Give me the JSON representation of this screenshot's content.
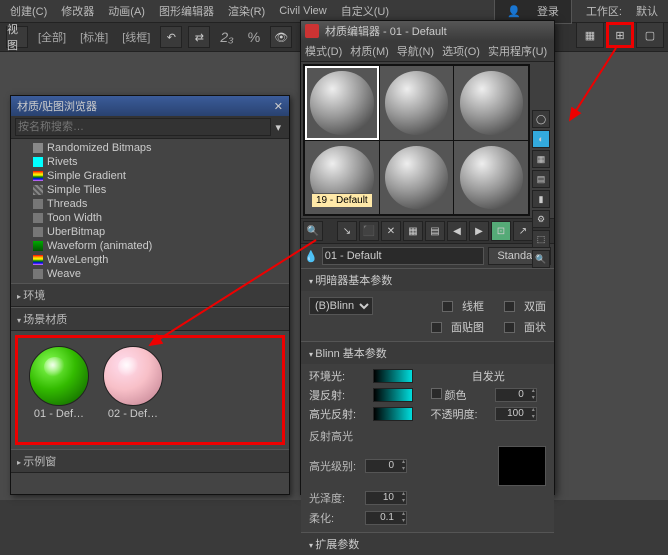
{
  "topMenu": {
    "create": "创建(C)",
    "mod": "修改器",
    "anim": "动画(A)",
    "graph": "图形编辑器",
    "render": "渲染(R)",
    "civil": "Civil View",
    "custom": "自定义(U)",
    "login": "登录",
    "workspace": "工作区:",
    "default": "默认"
  },
  "toolbar": {
    "view": "视图",
    "all": "[全部]",
    "hot": "[标准]",
    "line": "[线框]",
    "t1": "2₃",
    "tpct": "%"
  },
  "browser": {
    "title": "材质/贴图浏览器",
    "searchPh": "按名称搜索…",
    "items": [
      "Randomized Bitmaps",
      "Rivets",
      "Simple Gradient",
      "Simple Tiles",
      "Threads",
      "Toon Width",
      "UberBitmap",
      "Waveform (animated)",
      "WaveLength",
      "Weave"
    ],
    "envHdr": "环境",
    "sceneHdr": "场景材质",
    "mat1": "01 - Def…",
    "mat2": "02 - Def…",
    "sampleHdr": "示例窗"
  },
  "editor": {
    "title": "材质编辑器 - 01 - Default",
    "menu": {
      "mode": "模式(D)",
      "mat": "材质(M)",
      "nav": "导航(N)",
      "opt": "选项(O)",
      "util": "实用程序(U)"
    },
    "slotLabel": "19 - Default",
    "nameField": "01 - Default",
    "typeBtn": "Standard",
    "shaderHdr": "明暗器基本参数",
    "shader": "(B)Blinn",
    "wire": "线框",
    "twoSide": "双面",
    "faceMap": "面贴图",
    "faceted": "面状",
    "blinnHdr": "Blinn 基本参数",
    "ambient": "环境光:",
    "diffuse": "漫反射:",
    "specColor": "高光反射:",
    "selfIllum": "自发光",
    "colorCk": "颜色",
    "selfVal": "0",
    "opacity": "不透明度:",
    "opVal": "100",
    "specHdr": "反射高光",
    "specLevel": "高光级别:",
    "specVal": "0",
    "gloss": "光泽度:",
    "glossVal": "10",
    "soften": "柔化:",
    "softVal": "0.1",
    "extHdr": "扩展参数"
  }
}
